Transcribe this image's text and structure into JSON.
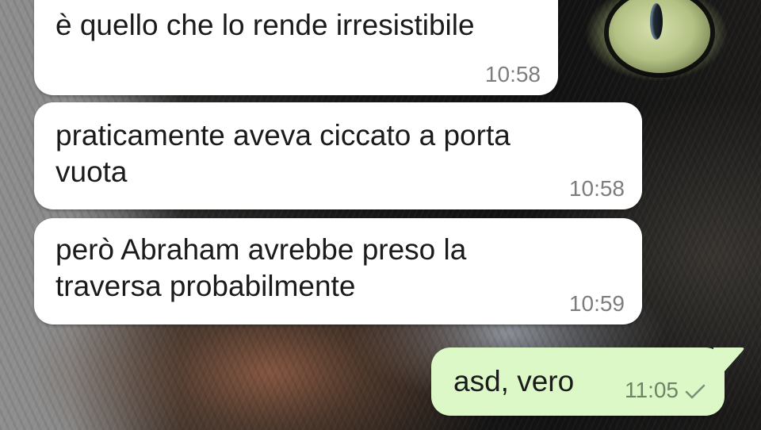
{
  "conversation": {
    "messages": [
      {
        "direction": "incoming",
        "text": "è quello che lo rende irresistibile",
        "time": "10:58"
      },
      {
        "direction": "incoming",
        "text": "praticamente aveva ciccato a porta\nvuota",
        "time": "10:58"
      },
      {
        "direction": "incoming",
        "text": "però Abraham avrebbe preso la\ntraversa probabilmente",
        "time": "10:59"
      },
      {
        "direction": "outgoing",
        "text": "asd, vero",
        "time": "11:05",
        "status_icon": "single-check-icon"
      }
    ]
  },
  "colors": {
    "incoming_bubble": "#ffffff",
    "outgoing_bubble": "#dcf8c6",
    "text": "#1b1b1b",
    "timestamp": "#7d7d7d"
  }
}
